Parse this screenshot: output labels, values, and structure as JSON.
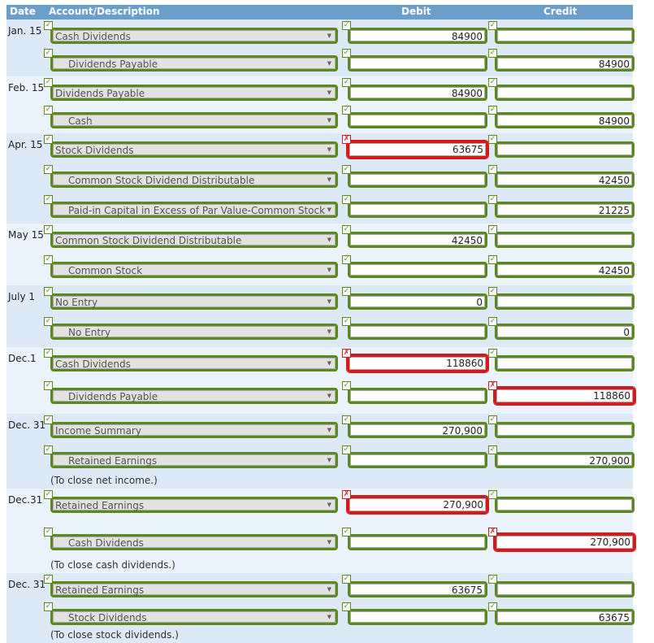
{
  "header": {
    "date": "Date",
    "account": "Account/Description",
    "debit": "Debit",
    "credit": "Credit"
  },
  "entries": [
    {
      "date": "Jan. 15",
      "rows": [
        {
          "account": "Cash Dividends",
          "indent": false,
          "account_ok": true,
          "debit": "84900",
          "debit_ok": true,
          "credit": "",
          "credit_ok": true
        },
        {
          "account": "Dividends Payable",
          "indent": true,
          "account_ok": true,
          "debit": "",
          "debit_ok": true,
          "credit": "84900",
          "credit_ok": true
        }
      ],
      "note": ""
    },
    {
      "date": "Feb. 15",
      "rows": [
        {
          "account": "Dividends Payable",
          "indent": false,
          "account_ok": true,
          "debit": "84900",
          "debit_ok": true,
          "credit": "",
          "credit_ok": true
        },
        {
          "account": "Cash",
          "indent": true,
          "account_ok": true,
          "debit": "",
          "debit_ok": true,
          "credit": "84900",
          "credit_ok": true
        }
      ],
      "note": ""
    },
    {
      "date": "Apr. 15",
      "rows": [
        {
          "account": "Stock Dividends",
          "indent": false,
          "account_ok": true,
          "debit": "63675",
          "debit_ok": false,
          "credit": "",
          "credit_ok": true
        },
        {
          "account": "Common Stock Dividend Distributable",
          "indent": true,
          "account_ok": true,
          "debit": "",
          "debit_ok": true,
          "credit": "42450",
          "credit_ok": true
        },
        {
          "account": "Paid-in Capital in Excess of Par Value-Common Stock",
          "indent": true,
          "account_ok": true,
          "debit": "",
          "debit_ok": true,
          "credit": "21225",
          "credit_ok": true
        }
      ],
      "note": ""
    },
    {
      "date": "May 15",
      "rows": [
        {
          "account": "Common Stock Dividend Distributable",
          "indent": false,
          "account_ok": true,
          "debit": "42450",
          "debit_ok": true,
          "credit": "",
          "credit_ok": true
        },
        {
          "account": "Common Stock",
          "indent": true,
          "account_ok": true,
          "debit": "",
          "debit_ok": true,
          "credit": "42450",
          "credit_ok": true
        }
      ],
      "note": ""
    },
    {
      "date": "July 1",
      "rows": [
        {
          "account": "No Entry",
          "indent": false,
          "account_ok": true,
          "debit": "0",
          "debit_ok": true,
          "credit": "",
          "credit_ok": true
        },
        {
          "account": "No Entry",
          "indent": true,
          "account_ok": true,
          "debit": "",
          "debit_ok": true,
          "credit": "0",
          "credit_ok": true
        }
      ],
      "note": ""
    },
    {
      "date": "Dec.1",
      "rows": [
        {
          "account": "Cash Dividends",
          "indent": false,
          "account_ok": true,
          "debit": "118860",
          "debit_ok": false,
          "credit": "",
          "credit_ok": true
        },
        {
          "account": "Dividends Payable",
          "indent": true,
          "account_ok": true,
          "debit": "",
          "debit_ok": true,
          "credit": "118860",
          "credit_ok": false
        }
      ],
      "note": ""
    },
    {
      "date": "Dec. 31",
      "rows": [
        {
          "account": "Income Summary",
          "indent": false,
          "account_ok": true,
          "debit": "270,900",
          "debit_ok": true,
          "credit": "",
          "credit_ok": true
        },
        {
          "account": "Retained Earnings",
          "indent": true,
          "account_ok": true,
          "debit": "",
          "debit_ok": true,
          "credit": "270,900",
          "credit_ok": true
        }
      ],
      "note": "(To close net income.)"
    },
    {
      "date": "Dec.31",
      "rows": [
        {
          "account": "Retained Earnings",
          "indent": false,
          "account_ok": true,
          "debit": "270,900",
          "debit_ok": false,
          "credit": "",
          "credit_ok": true
        },
        {
          "account": "Cash Dividends",
          "indent": true,
          "account_ok": true,
          "debit": "",
          "debit_ok": true,
          "credit": "270,900",
          "credit_ok": false
        }
      ],
      "note": "(To close cash dividends.)"
    },
    {
      "date": "Dec. 31",
      "rows": [
        {
          "account": "Retained Earnings",
          "indent": false,
          "account_ok": true,
          "debit": "63675",
          "debit_ok": true,
          "credit": "",
          "credit_ok": true
        },
        {
          "account": "Stock Dividends",
          "indent": true,
          "account_ok": true,
          "debit": "",
          "debit_ok": true,
          "credit": "63675",
          "credit_ok": true
        }
      ],
      "note": "(To close stock dividends.)"
    }
  ],
  "icons": {
    "correct": "✓",
    "incorrect": "✗",
    "dropdown": "▼"
  },
  "colors": {
    "header": "#6a9fcb",
    "correct": "#5a8a1e",
    "incorrect": "#d7191c",
    "row_a": "#dde9f7",
    "row_b": "#ebf3fd"
  }
}
